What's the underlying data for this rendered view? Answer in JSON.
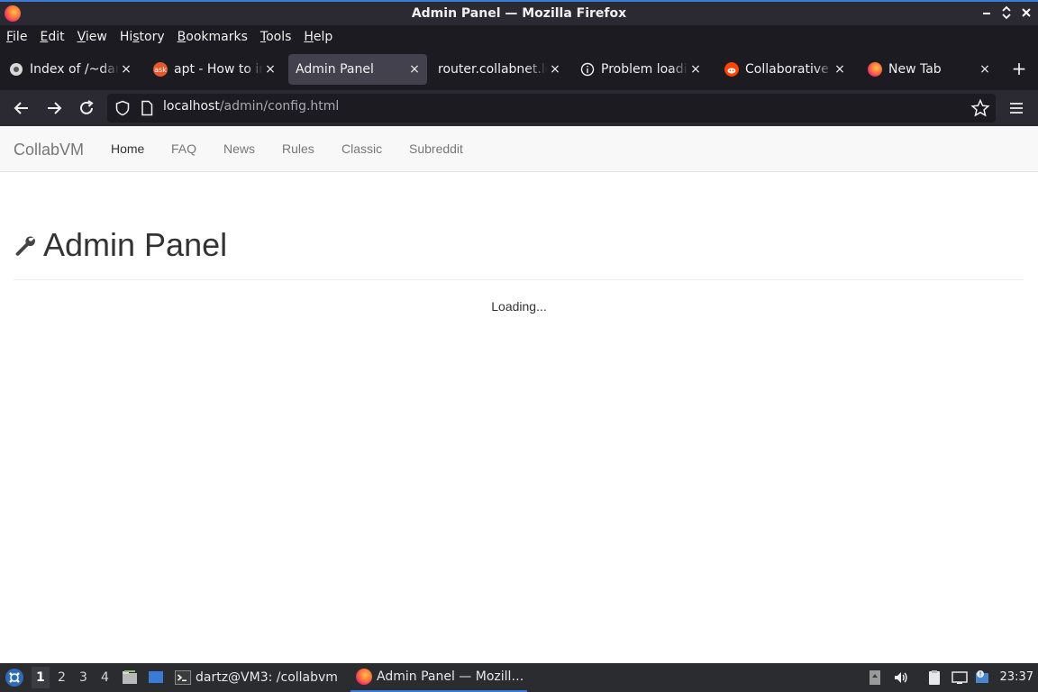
{
  "window": {
    "title": "Admin Panel — Mozilla Firefox",
    "controls": [
      "minimize-icon",
      "maximize-icon",
      "close-icon"
    ]
  },
  "menubar": {
    "items": [
      {
        "key": "F",
        "rest": "ile"
      },
      {
        "key": "E",
        "rest": "dit"
      },
      {
        "key": "V",
        "rest": "iew"
      },
      {
        "pre": "Hi",
        "key": "s",
        "rest": "tory"
      },
      {
        "key": "B",
        "rest": "ookmarks"
      },
      {
        "key": "T",
        "rest": "ools"
      },
      {
        "key": "H",
        "rest": "elp"
      }
    ]
  },
  "tabs": [
    {
      "label": "Index of /~dartz",
      "icon": "page-icon"
    },
    {
      "label": "apt - How to install",
      "icon": "askubuntu-icon"
    },
    {
      "label": "Admin Panel",
      "icon": "none",
      "active": true
    },
    {
      "label": "router.collabnet.local",
      "icon": "none"
    },
    {
      "label": "Problem loading page",
      "icon": "info-icon"
    },
    {
      "label": "Collaborative Virtual",
      "icon": "reddit-icon"
    },
    {
      "label": "New Tab",
      "icon": "firefox-icon"
    }
  ],
  "urlbar": {
    "host": "localhost",
    "path": "/admin/config.html"
  },
  "site": {
    "brand": "CollabVM",
    "nav": [
      "Home",
      "FAQ",
      "News",
      "Rules",
      "Classic",
      "Subreddit"
    ],
    "active_nav": "Home",
    "heading": "Admin Panel",
    "status": "Loading..."
  },
  "taskbar": {
    "workspaces": [
      "1",
      "2",
      "3",
      "4"
    ],
    "active_workspace": "1",
    "tasks": [
      {
        "label": "dartz@VM3: /collabvm",
        "icon": "terminal-icon"
      },
      {
        "label": "Admin Panel — Mozill…",
        "icon": "firefox-icon",
        "active": true
      }
    ],
    "clock": "23:37"
  },
  "colors": {
    "accent": "#3d7ad8",
    "chrome_dark": "#1c1b22",
    "chrome": "#2b2a33",
    "active_tab": "#42414d"
  }
}
